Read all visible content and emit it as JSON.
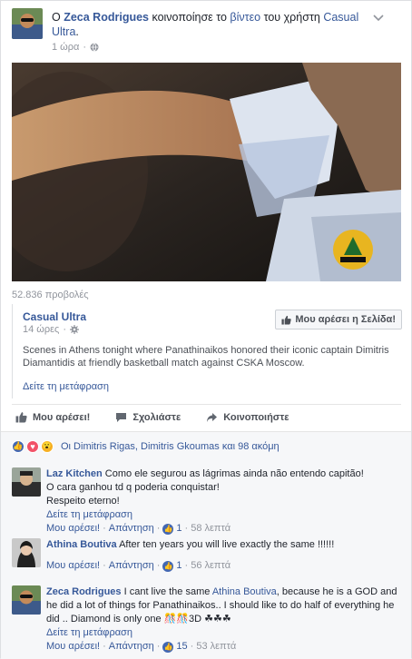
{
  "post": {
    "prefix": "Ο",
    "author": "Zeca Rodrigues",
    "action": "κοινοποίησε το",
    "object": "βίντεο",
    "of_user": "του χρήστη",
    "page_name": "Casual Ultra",
    "time": "1 ώρα",
    "views": "52.836 προβολές"
  },
  "shared": {
    "page": "Casual Ultra",
    "time": "14 ώρες",
    "like_page_label": "Μου αρέσει η Σελίδα!",
    "description": "Scenes in Athens tonight where Panathinaikos honored their iconic captain Dimitris Diamantidis at friendly basketball match against CSKA Moscow.",
    "translate": "Δείτε τη μετάφραση"
  },
  "actions": {
    "like": "Μου αρέσει!",
    "comment": "Σχολιάστε",
    "share": "Κοινοποιήστε"
  },
  "reactions": {
    "text": "Οι Dimitris Rigas, Dimitris Gkoumas και 98 ακόμη"
  },
  "comments": [
    {
      "author": "Laz Kitchen",
      "lines": [
        "Como ele segurou as lágrimas ainda não entendo capitão!",
        "O cara ganhou td q poderia conquistar!",
        "Respeito eterno!"
      ],
      "translate": "Δείτε τη μετάφραση",
      "like": "Μου αρέσει!",
      "reply": "Απάντηση",
      "likes": "1",
      "time": "58 λεπτά"
    },
    {
      "author": "Athina Boutiva",
      "text": "After ten years you will live exactly the same !!!!!!",
      "like": "Μου αρέσει!",
      "reply": "Απάντηση",
      "likes": "1",
      "time": "56 λεπτά"
    },
    {
      "author": "Zeca Rodrigues",
      "text_a": "I cant live the same",
      "mention": "Athina Boutiva",
      "text_b": ", because he is a GOD and he did a lot of things for Panathinaikos.. I should like to do half of everything he did .. Diamond is only one",
      "emoji": "🎊🎊3D ☘☘☘",
      "translate": "Δείτε τη μετάφραση",
      "like": "Μου αρέσει!",
      "reply": "Απάντηση",
      "likes": "15",
      "time": "53 λεπτά"
    }
  ],
  "colors": {
    "link": "#365899",
    "meta": "#90949c",
    "like_blue": "#4267b2"
  },
  "icons": {
    "globe": "globe-icon",
    "gear": "gear-icon",
    "thumb": "thumbs-up-icon",
    "comment": "comment-icon",
    "share": "share-icon",
    "chevron": "chevron-down-icon"
  }
}
